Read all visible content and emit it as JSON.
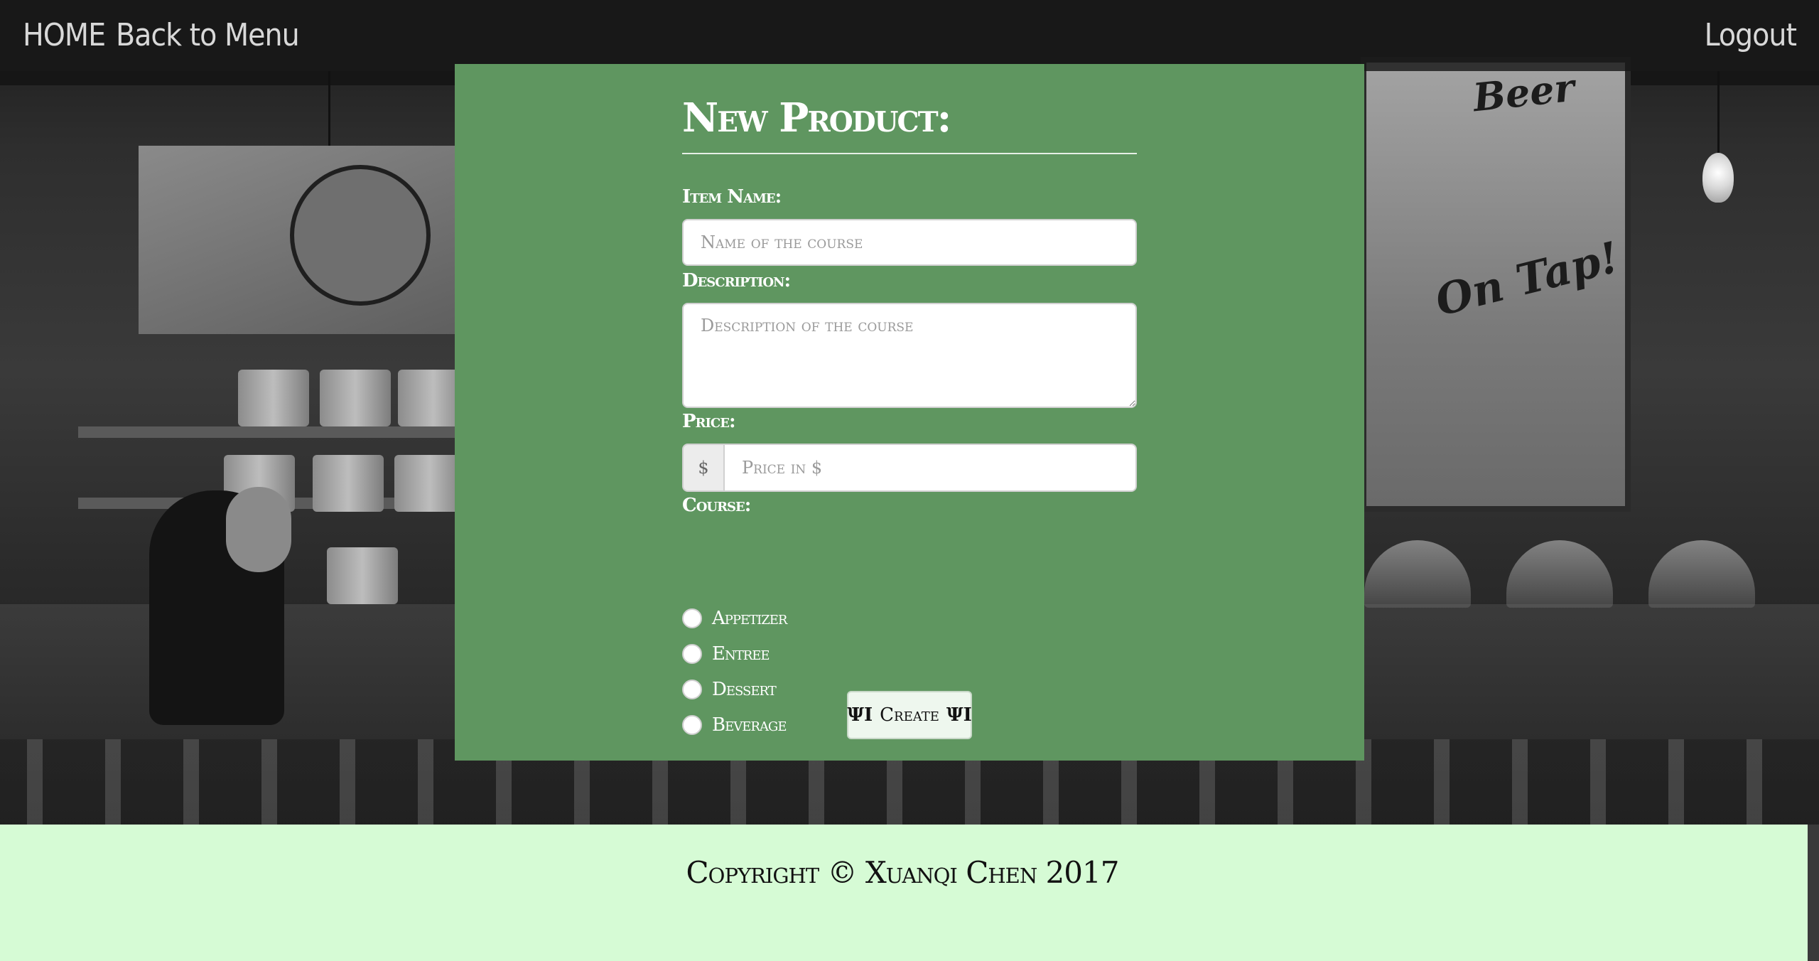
{
  "nav": {
    "home": "HOME",
    "back_to_menu": "Back to Menu",
    "logout": "Logout"
  },
  "form": {
    "title": "New Product:",
    "item_name_label": "Item Name:",
    "item_name_placeholder": "Name of the course",
    "description_label": "Description:",
    "description_placeholder": "Description of the course",
    "price_label": "Price:",
    "price_addon": "$",
    "price_placeholder": "Price in $",
    "course_label": "Course:",
    "course_options": [
      "Appetizer",
      "Entree",
      "Dessert",
      "Beverage"
    ],
    "create_button": "Create",
    "button_icon": "cutlery-icon"
  },
  "background": {
    "poster_top": "Beer",
    "poster_middle": "On Tap!"
  },
  "footer": {
    "copyright": "Copyright © Xuanqi Chen 2017"
  },
  "colors": {
    "panel": "#5f9660",
    "footer": "#d6fbd5",
    "navbar": "#191919"
  }
}
